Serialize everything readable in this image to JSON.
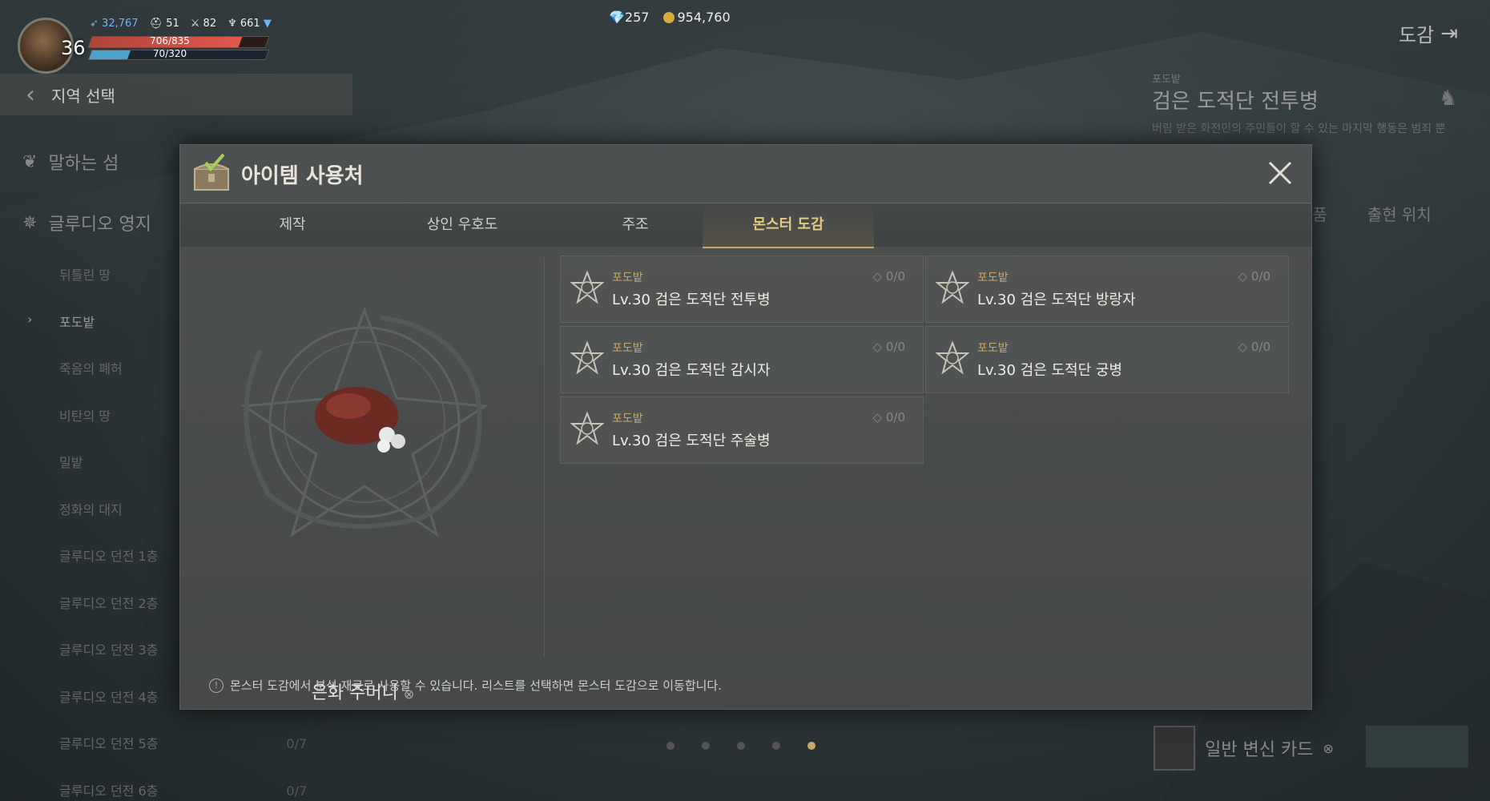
{
  "hud": {
    "level": "36",
    "power": "32,767",
    "stat2": "51",
    "stat3": "82",
    "stat4": "661",
    "hp": "706/835",
    "hp_fraction": 0.85,
    "mp": "70/320",
    "mp_fraction": 0.22
  },
  "currency": {
    "gems": "257",
    "gold": "954,760"
  },
  "top_right": {
    "label": "도감"
  },
  "sidebar": {
    "region_select": "지역 선택",
    "groups": [
      {
        "label": "말하는 섬",
        "icon": "tree-icon"
      },
      {
        "label": "글루디오 영지",
        "icon": "star-emblem-icon"
      }
    ],
    "items": [
      {
        "label": "뒤틀린 땅"
      },
      {
        "label": "포도밭",
        "selected": true
      },
      {
        "label": "죽음의 폐허"
      },
      {
        "label": "비탄의 땅"
      },
      {
        "label": "밀밭"
      },
      {
        "label": "정화의 대지"
      },
      {
        "label": "글루디오 던전 1층"
      },
      {
        "label": "글루디오 던전 2층"
      },
      {
        "label": "글루디오 던전 3층"
      },
      {
        "label": "글루디오 던전 4층"
      },
      {
        "label": "글루디오 던전 5층",
        "extra": "0/7"
      },
      {
        "label": "글루디오 던전 6층",
        "extra": "0/7"
      }
    ]
  },
  "right_panel": {
    "region": "포도밭",
    "title": "검은 도적단 전투병",
    "desc": "버림 받은 화전민의 주민들이 할 수 있는 마지막 행동은 범죄 뿐",
    "tabs": [
      "리품",
      "출현 위치"
    ],
    "card": "일반 변신 카드"
  },
  "pager": {
    "count": 5,
    "active": 4
  },
  "dialog": {
    "title": "아이템 사용처",
    "tabs": [
      {
        "label": "제작"
      },
      {
        "label": "상인 우호도"
      },
      {
        "label": "주조"
      },
      {
        "label": "몬스터 도감",
        "active": true
      }
    ],
    "item_name": "은화 주머니",
    "entries": [
      {
        "region": "포도밭",
        "name": "Lv.30 검은 도적단 전투병",
        "count": "0/0"
      },
      {
        "region": "포도밭",
        "name": "Lv.30 검은 도적단 방랑자",
        "count": "0/0"
      },
      {
        "region": "포도밭",
        "name": "Lv.30 검은 도적단 감시자",
        "count": "0/0"
      },
      {
        "region": "포도밭",
        "name": "Lv.30 검은 도적단 궁병",
        "count": "0/0"
      },
      {
        "region": "포도밭",
        "name": "Lv.30 검은 도적단 주술병",
        "count": "0/0"
      }
    ],
    "footer": "몬스터 도감에서 분석 재료로 사용할 수 있습니다. 리스트를 선택하면 몬스터 도감으로 이동합니다.",
    "footer_icon": "!"
  },
  "colors": {
    "accent": "#c9a968",
    "hp": "#d9534a",
    "mp": "#4aa2cc",
    "power": "#6fb4ff"
  }
}
